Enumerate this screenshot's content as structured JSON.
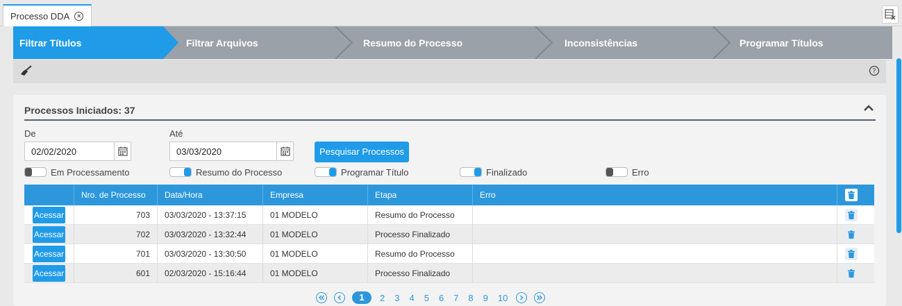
{
  "tab": {
    "label": "Processo DDA"
  },
  "wizard": {
    "steps": [
      {
        "label": "Filtrar Títulos",
        "active": true
      },
      {
        "label": "Filtrar Arquivos",
        "active": false
      },
      {
        "label": "Resumo do Processo",
        "active": false
      },
      {
        "label": "Inconsistências",
        "active": false
      },
      {
        "label": "Programar Títulos",
        "active": false
      }
    ]
  },
  "toolbar": {
    "clear_icon": "broom-icon",
    "help_icon": "help-icon"
  },
  "panel": {
    "title": "Processos Iniciados: 37",
    "from_label": "De",
    "from_value": "02/02/2020",
    "to_label": "Até",
    "to_value": "03/03/2020",
    "search_button": "Pesquisar Processos",
    "filters": [
      {
        "label": "Em Processamento",
        "on": false,
        "color": "#555555"
      },
      {
        "label": "Resumo do Processo",
        "on": true,
        "color": "#1f9be8"
      },
      {
        "label": "Programar Título",
        "on": true,
        "color": "#1f9be8"
      },
      {
        "label": "Finalizado",
        "on": true,
        "color": "#1f9be8"
      },
      {
        "label": "Erro",
        "on": false,
        "color": "#555555"
      }
    ]
  },
  "table": {
    "columns": [
      "",
      "Nro. de Processo",
      "Data/Hora",
      "Empresa",
      "Etapa",
      "Erro"
    ],
    "action_label": "Acessar",
    "rows": [
      {
        "nro": "703",
        "datahora": "03/03/2020 - 13:37:15",
        "empresa": "01 MODELO",
        "etapa": "Resumo do Processo",
        "erro": ""
      },
      {
        "nro": "702",
        "datahora": "03/03/2020 - 13:32:44",
        "empresa": "01 MODELO",
        "etapa": "Processo Finalizado",
        "erro": ""
      },
      {
        "nro": "701",
        "datahora": "03/03/2020 - 13:30:50",
        "empresa": "01 MODELO",
        "etapa": "Resumo do Processo",
        "erro": ""
      },
      {
        "nro": "601",
        "datahora": "02/03/2020 - 15:16:44",
        "empresa": "01 MODELO",
        "etapa": "Processo Finalizado",
        "erro": ""
      }
    ]
  },
  "pager": {
    "pages": [
      "1",
      "2",
      "3",
      "4",
      "5",
      "6",
      "7",
      "8",
      "9",
      "10"
    ],
    "current": "1"
  },
  "colors": {
    "accent": "#1f9be8",
    "wizard_inactive": "#9aa1a8",
    "header": "#2d97dc"
  }
}
